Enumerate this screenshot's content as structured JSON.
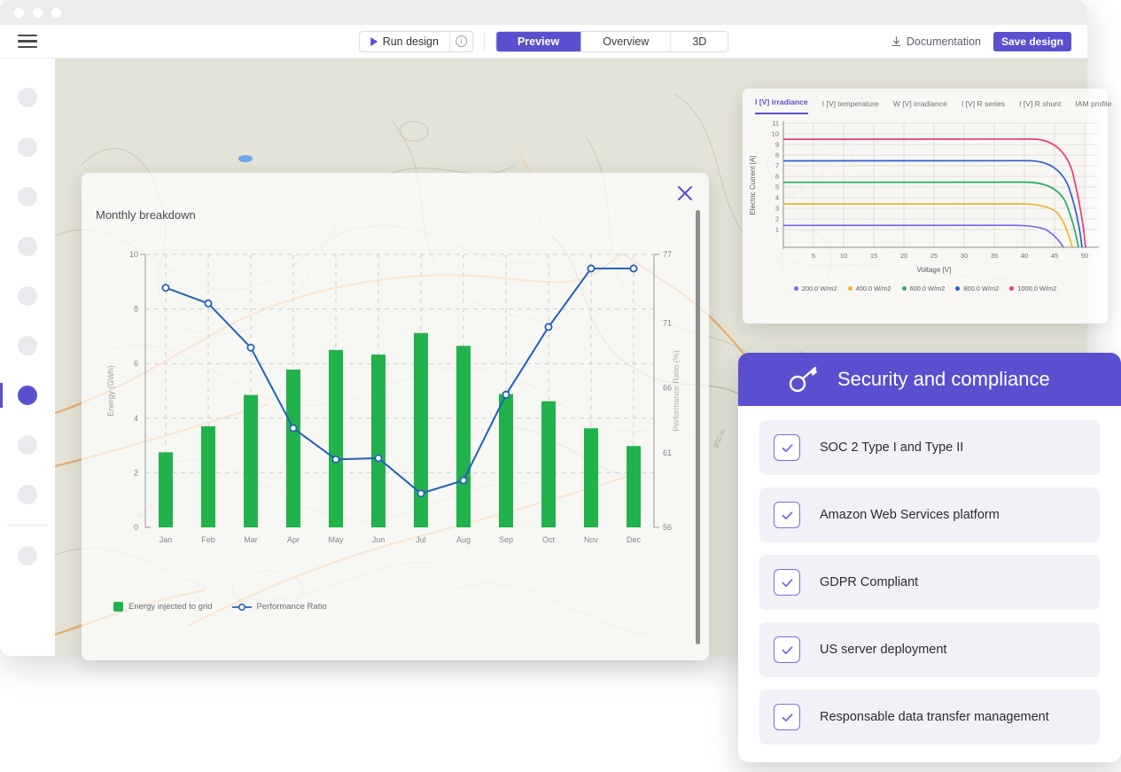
{
  "window": {
    "titlebar_dots": 3,
    "toolbar": {
      "menu_icon": "hamburger-icon",
      "run_label": "Run design",
      "info_icon": "info-icon",
      "segments": [
        {
          "label": "Preview",
          "active": true
        },
        {
          "label": "Overview",
          "active": false
        },
        {
          "label": "3D",
          "active": false
        }
      ],
      "documentation_label": "Documentation",
      "documentation_icon": "download-icon",
      "save_label": "Save design"
    },
    "sidebar": {
      "items": [
        {
          "name": "sidebar-item-1",
          "active": false
        },
        {
          "name": "sidebar-item-2",
          "active": false
        },
        {
          "name": "sidebar-item-3",
          "active": false
        },
        {
          "name": "sidebar-item-4",
          "active": false
        },
        {
          "name": "sidebar-item-5",
          "active": false
        },
        {
          "name": "sidebar-item-6",
          "active": false
        },
        {
          "name": "sidebar-item-7",
          "active": true
        },
        {
          "name": "sidebar-item-8",
          "active": false
        },
        {
          "name": "sidebar-item-9",
          "active": false
        },
        {
          "name": "sidebar-item-10",
          "active": false
        }
      ]
    }
  },
  "modal": {
    "title": "Monthly breakdown",
    "close_icon": "close-icon",
    "scrollbar": "vertical-scrollbar"
  },
  "security_card": {
    "icon": "key-icon",
    "title": "Security and compliance",
    "accent": "#5a4fcf",
    "items": [
      "SOC 2 Type I and Type II",
      "Amazon Web Services platform",
      "GDPR Compliant",
      "US server deployment",
      "Responsable data transfer management"
    ]
  },
  "iv_panel": {
    "tabs": [
      {
        "label": "I [V] irradiance",
        "active": true
      },
      {
        "label": "I [V] temperature",
        "active": false
      },
      {
        "label": "W [V] irradiance",
        "active": false
      },
      {
        "label": "I [V] R series",
        "active": false
      },
      {
        "label": "I [V] R shunt",
        "active": false
      },
      {
        "label": "IAM profile",
        "active": false
      }
    ]
  },
  "chart_data": [
    {
      "type": "bar",
      "title": "Monthly breakdown",
      "categories": [
        "Jan",
        "Feb",
        "Mar",
        "Apr",
        "May",
        "Jun",
        "Jul",
        "Aug",
        "Sep",
        "Oct",
        "Nov",
        "Dec"
      ],
      "xlabel": "",
      "ylabel": "Energy (GWh)",
      "ylim": [
        0,
        10
      ],
      "yticks": [
        0,
        2,
        4,
        6,
        8,
        10
      ],
      "y2label": "Performance Ratio (%)",
      "y2lim": [
        56,
        77
      ],
      "y2ticks": [
        56,
        61,
        66,
        71,
        77
      ],
      "grid": true,
      "legend_position": "bottom-left",
      "series": [
        {
          "name": "Energy injected to grid",
          "type": "bar",
          "color": "#22b24c",
          "axis": "left",
          "values": [
            2.75,
            3.7,
            4.85,
            5.78,
            6.5,
            6.33,
            7.12,
            6.65,
            4.88,
            4.62,
            3.63,
            2.98
          ]
        },
        {
          "name": "Performance Ratio",
          "type": "line",
          "color": "#2161b8",
          "axis": "right",
          "values": [
            74.4,
            73.2,
            69.8,
            63.6,
            61.2,
            61.3,
            58.6,
            59.6,
            66.2,
            71.4,
            75.9,
            75.9
          ]
        }
      ]
    },
    {
      "type": "line",
      "title": "I [V] irradiance",
      "xlabel": "Voltage [V]",
      "ylabel": "Electric Current [A]",
      "xlim": [
        0,
        52
      ],
      "xticks": [
        5,
        10,
        15,
        20,
        25,
        30,
        35,
        40,
        45,
        50
      ],
      "ylim": [
        0,
        11.6
      ],
      "yticks": [
        1,
        2,
        3,
        4,
        5,
        6,
        7,
        8,
        9,
        10,
        11
      ],
      "grid": true,
      "legend_position": "bottom",
      "series": [
        {
          "name": "200.0 W/m2",
          "color": "#7b68ee",
          "isc": 2.05,
          "voc": 46.8
        },
        {
          "name": "400.0 W/m2",
          "color": "#f0b429",
          "isc": 4.08,
          "voc": 48.2
        },
        {
          "name": "600.0 W/m2",
          "color": "#27ae60",
          "isc": 6.07,
          "voc": 49.0
        },
        {
          "name": "800.0 W/m2",
          "color": "#2a5fd0",
          "isc": 8.08,
          "voc": 49.5
        },
        {
          "name": "1000.0 W/m2",
          "color": "#ec3b78",
          "isc": 10.1,
          "voc": 50.0
        }
      ]
    }
  ]
}
